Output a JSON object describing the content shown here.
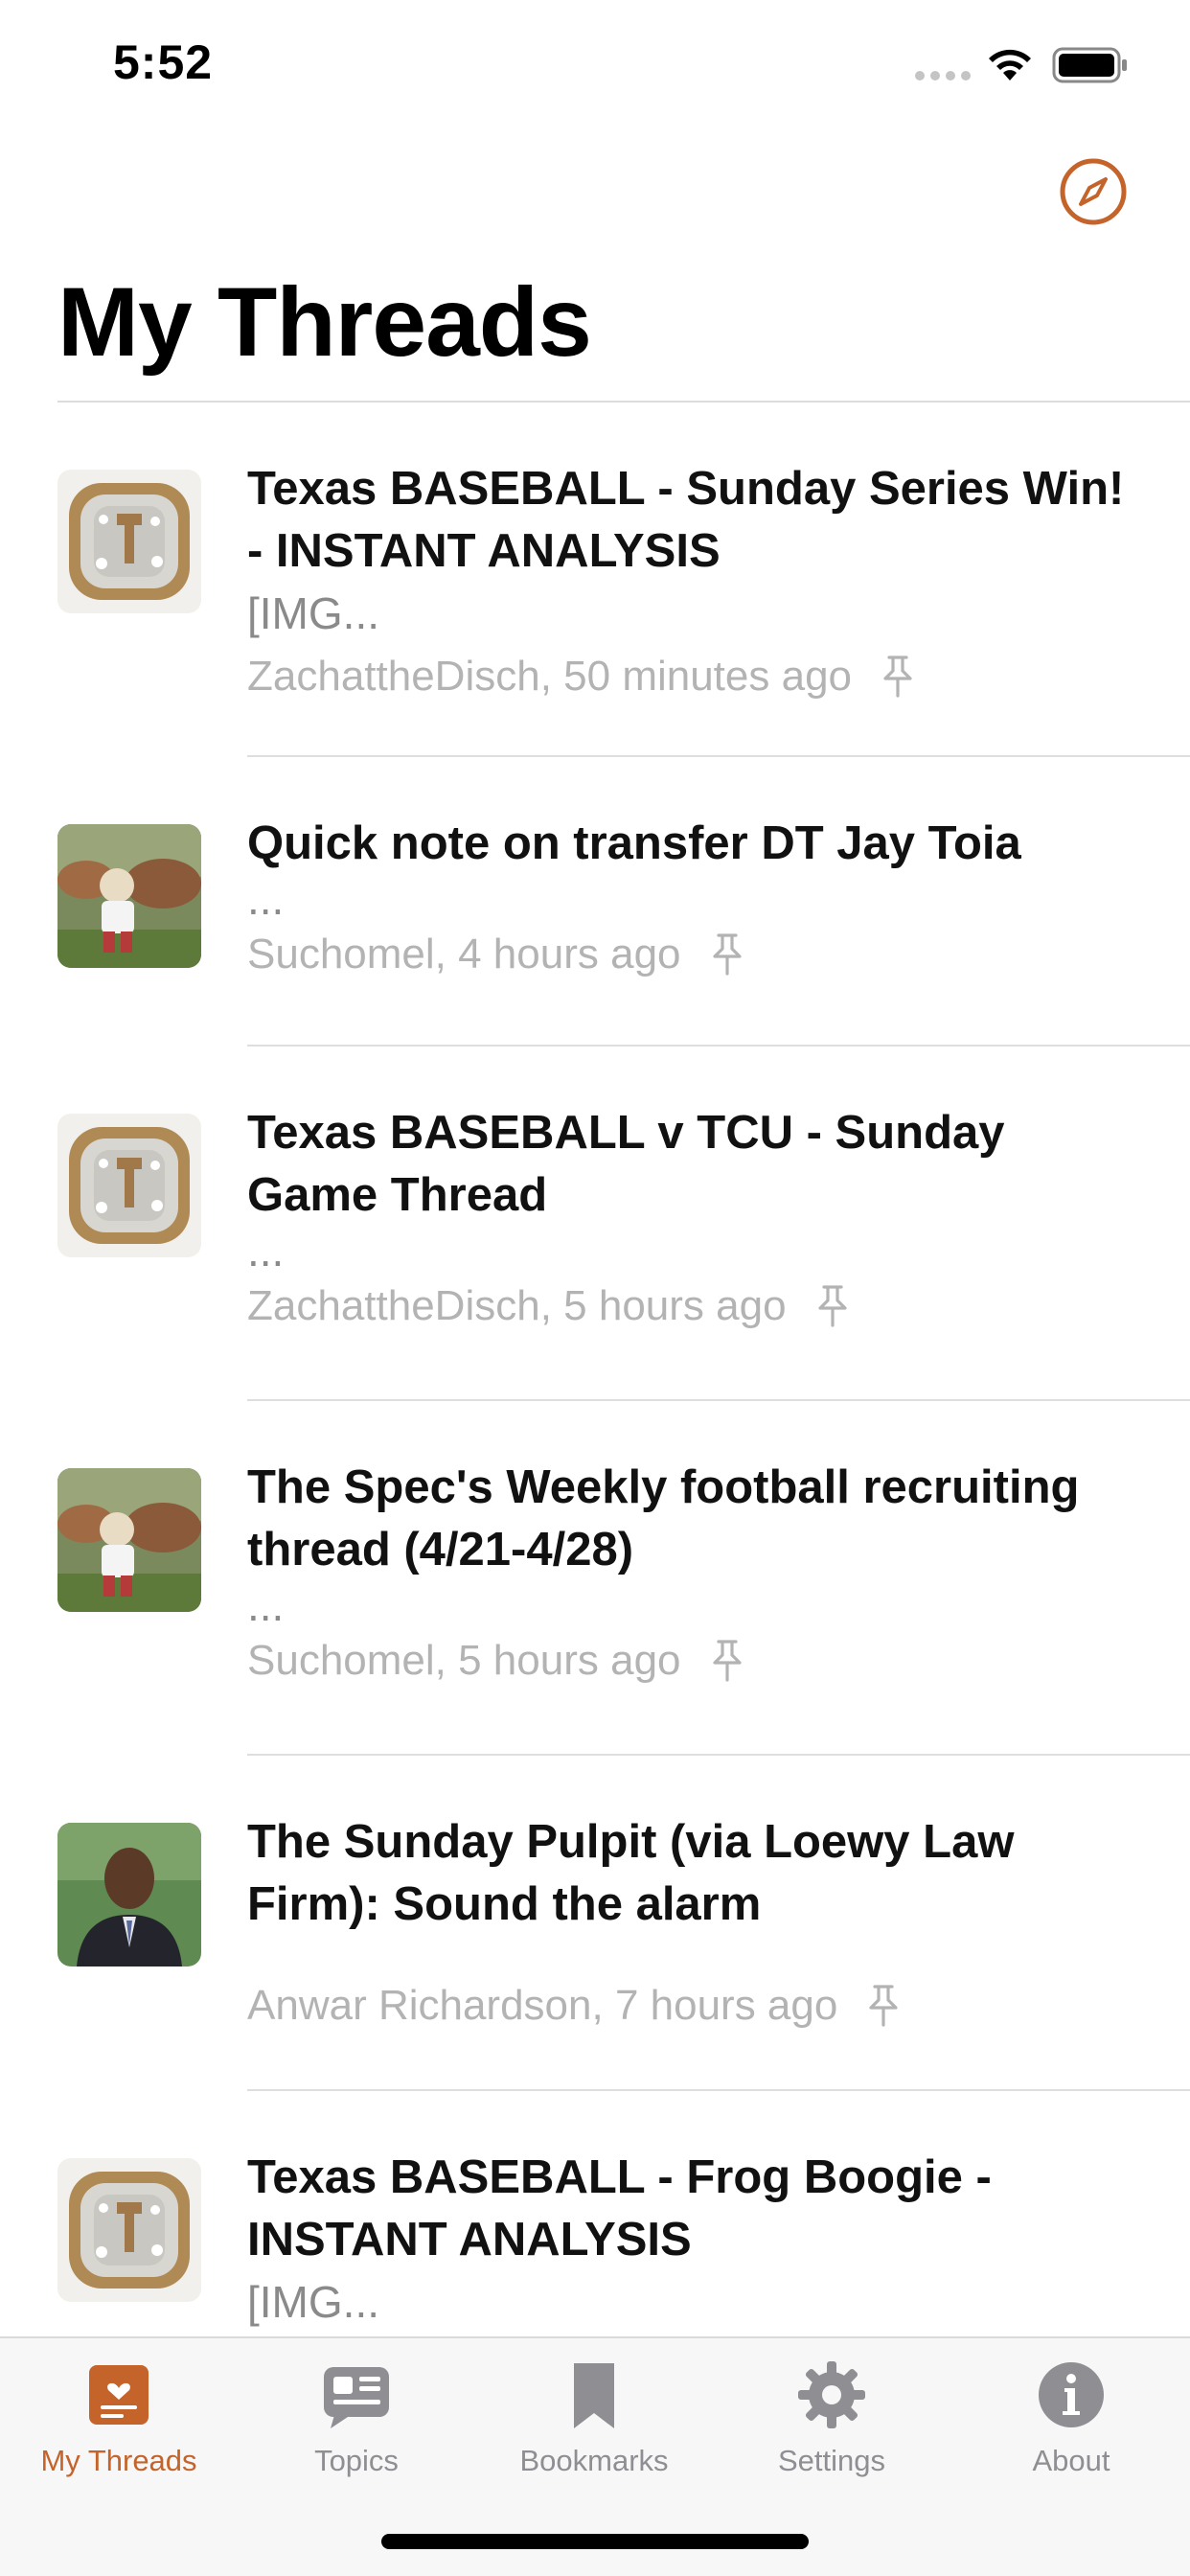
{
  "status_bar": {
    "time": "5:52"
  },
  "header": {
    "title": "My Threads"
  },
  "colors": {
    "accent": "#c4642b",
    "inactive": "#8e8e93"
  },
  "threads": [
    {
      "title": "Texas BASEBALL - Sunday Series Win! - INSTANT ANALYSIS",
      "preview": "[IMG...",
      "meta": "ZachattheDisch, 50 minutes ago",
      "avatar": "ring-avatar"
    },
    {
      "title": "Quick note on transfer DT Jay Toia",
      "preview": "...",
      "meta": "Suchomel, 4 hours ago",
      "avatar": "child-cattle-avatar"
    },
    {
      "title": "Texas BASEBALL v TCU - Sunday Game Thread",
      "preview": "...",
      "meta": "ZachattheDisch, 5 hours ago",
      "avatar": "ring-avatar"
    },
    {
      "title": "The Spec's Weekly football recruiting thread (4/21-4/28)",
      "preview": "...",
      "meta": "Suchomel, 5 hours ago",
      "avatar": "child-cattle-avatar"
    },
    {
      "title": "The Sunday Pulpit (via Loewy Law Firm): Sound the alarm",
      "preview": "",
      "meta": "Anwar Richardson, 7 hours ago",
      "avatar": "man-portrait-avatar"
    },
    {
      "title": "Texas BASEBALL - Frog Boogie - INSTANT ANALYSIS",
      "preview": "[IMG...",
      "meta": "",
      "avatar": "ring-avatar"
    }
  ],
  "tabs": [
    {
      "label": "My Threads",
      "icon": "my-threads-icon",
      "active": true
    },
    {
      "label": "Topics",
      "icon": "topics-icon",
      "active": false
    },
    {
      "label": "Bookmarks",
      "icon": "bookmark-icon",
      "active": false
    },
    {
      "label": "Settings",
      "icon": "gear-icon",
      "active": false
    },
    {
      "label": "About",
      "icon": "info-icon",
      "active": false
    }
  ]
}
